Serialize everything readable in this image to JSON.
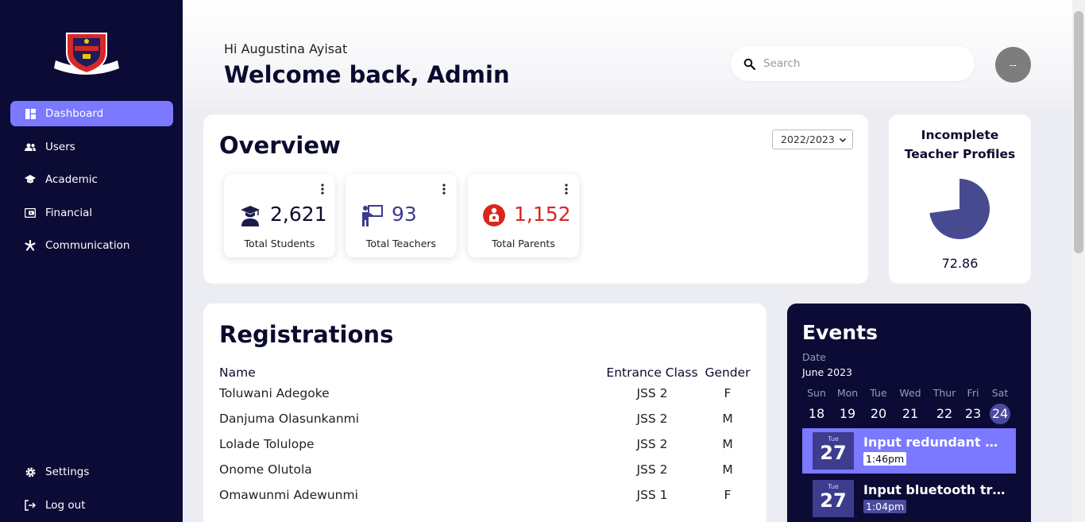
{
  "colors": {
    "sidebar": "#0b0b36",
    "accent": "#7b79ff",
    "pie": "#474a8f",
    "parents": "#d9261c",
    "teachers": "#3d3c8f"
  },
  "sidebar": {
    "items": [
      {
        "label": "Dashboard",
        "icon": "dashboard-icon",
        "active": true
      },
      {
        "label": "Users",
        "icon": "users-icon"
      },
      {
        "label": "Academic",
        "icon": "graduation-cap-icon"
      },
      {
        "label": "Financial",
        "icon": "wallet-icon"
      },
      {
        "label": "Communication",
        "icon": "asterisk-icon"
      }
    ],
    "bottom": [
      {
        "label": "Settings",
        "icon": "gear-icon"
      },
      {
        "label": "Log out",
        "icon": "logout-icon"
      }
    ]
  },
  "header": {
    "greeting": "Hi Augustina Ayisat",
    "welcome": "Welcome back, Admin",
    "search_placeholder": "Search",
    "avatar_text": "--"
  },
  "overview": {
    "title": "Overview",
    "year": "2022/2023",
    "stats": [
      {
        "value": "2,621",
        "label": "Total Students",
        "icon": "student-icon"
      },
      {
        "value": "93",
        "label": "Total Teachers",
        "icon": "teacher-icon"
      },
      {
        "value": "1,152",
        "label": "Total Parents",
        "icon": "parent-icon"
      }
    ]
  },
  "incomplete": {
    "title": "Incomplete Teacher Profiles",
    "value": "72.86",
    "fraction": 0.7286
  },
  "registrations": {
    "title": "Registrations",
    "columns": [
      "Name",
      "Entrance Class",
      "Gender"
    ],
    "rows": [
      [
        "Toluwani Adegoke",
        "JSS 2",
        "F"
      ],
      [
        "Danjuma Olasunkanmi",
        "JSS 2",
        "M"
      ],
      [
        "Lolade Tolulope",
        "JSS 2",
        "M"
      ],
      [
        "Onome Olutola",
        "JSS 2",
        "M"
      ],
      [
        "Omawunmi Adewunmi",
        "JSS 1",
        "F"
      ]
    ]
  },
  "events": {
    "title": "Events",
    "date_label": "Date",
    "month": "June 2023",
    "days": [
      {
        "name": "Sun",
        "num": "18"
      },
      {
        "name": "Mon",
        "num": "19"
      },
      {
        "name": "Tue",
        "num": "20"
      },
      {
        "name": "Wed",
        "num": "21"
      },
      {
        "name": "Thur",
        "num": "22"
      },
      {
        "name": "Fri",
        "num": "23"
      },
      {
        "name": "Sat",
        "num": "24"
      }
    ],
    "items": [
      {
        "weekday": "Tue",
        "day": "27",
        "name": "Input redundant matrix",
        "time": "1:46pm"
      },
      {
        "weekday": "Tue",
        "day": "27",
        "name": "Input bluetooth transmitter",
        "time": "1:04pm"
      }
    ]
  }
}
